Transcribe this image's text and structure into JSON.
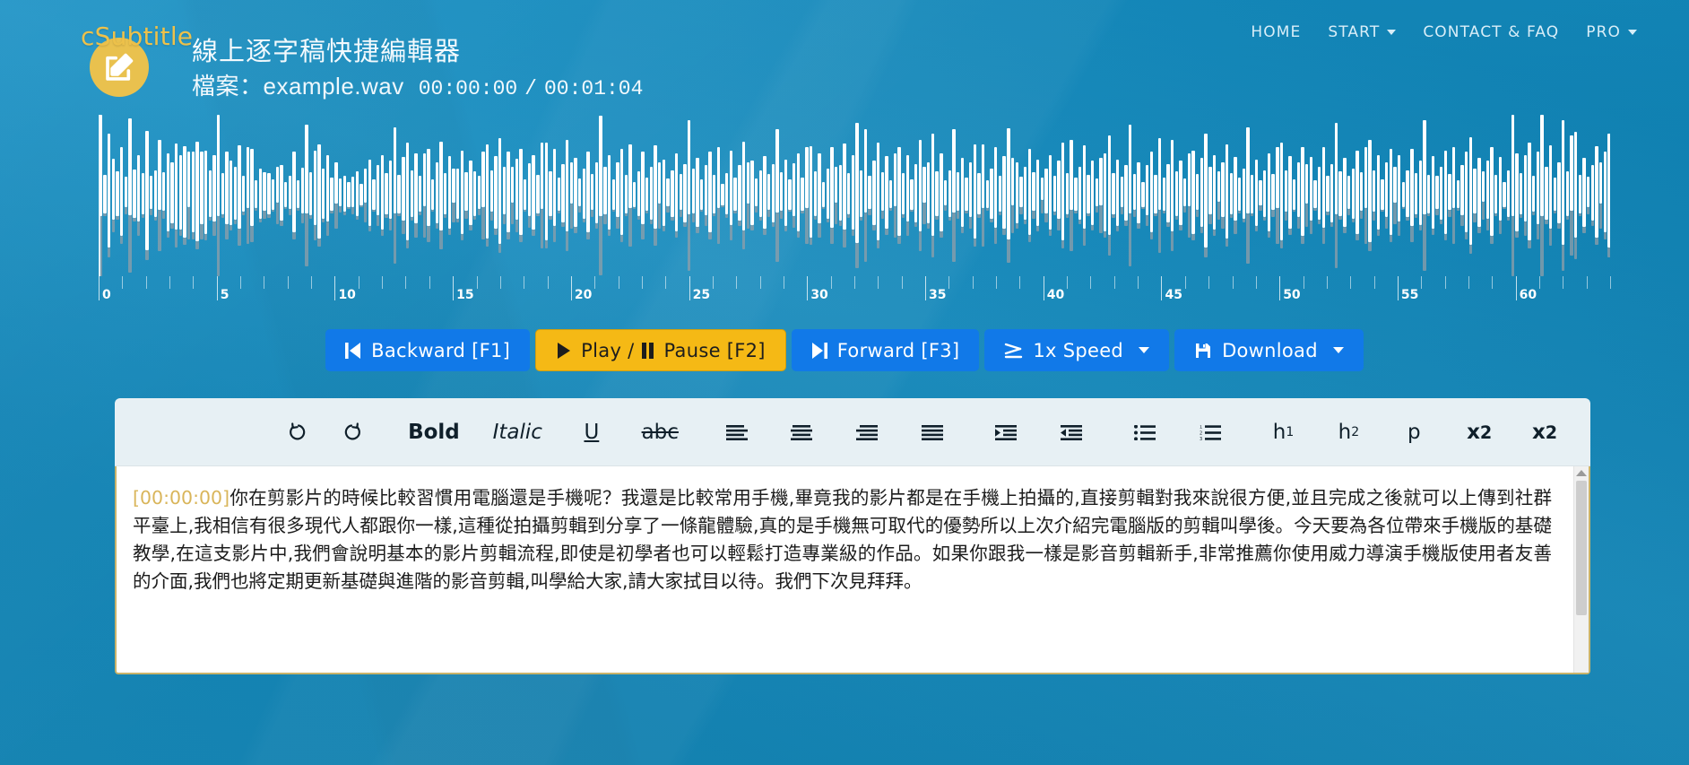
{
  "brand": {
    "logo_name": "cSubtitle",
    "logo_icon": "edit-square-icon"
  },
  "header": {
    "title": "線上逐字稿快捷編輯器",
    "file_label": "檔案：",
    "file_name": "example.wav",
    "time_current": "00:00:00",
    "time_separator": "/",
    "time_total": "00:01:04"
  },
  "nav": {
    "items": [
      {
        "label": "HOME",
        "has_caret": false
      },
      {
        "label": "START",
        "has_caret": true
      },
      {
        "label": "CONTACT & FAQ",
        "has_caret": false
      },
      {
        "label": "PRO",
        "has_caret": true
      }
    ]
  },
  "waveform": {
    "ruler_labels": [
      "0",
      "5",
      "10",
      "15",
      "20",
      "25",
      "30",
      "35",
      "40",
      "45",
      "50",
      "55",
      "60"
    ],
    "ruler_max_seconds": 64,
    "ruler_tick_interval": 1,
    "ruler_label_interval": 5,
    "playhead_seconds": 0,
    "peaks": [
      0.96,
      0.28,
      0.82,
      0.44,
      0.32,
      0.64,
      0.22,
      0.7,
      0.35,
      0.48,
      0.3,
      0.86,
      0.24,
      0.34,
      0.5,
      0.28,
      0.56,
      0.44,
      0.62,
      0.54,
      0.66,
      0.4,
      0.58,
      0.72,
      0.52,
      0.6,
      0.34,
      0.48,
      0.78,
      0.3,
      0.52,
      0.46,
      0.38,
      0.6,
      0.26,
      0.44,
      0.56,
      0.2,
      0.36,
      0.28,
      0.3,
      0.22,
      0.26,
      0.4,
      0.18,
      0.24,
      0.58,
      0.2,
      0.33,
      0.64,
      0.31,
      0.54,
      0.68,
      0.36,
      0.48,
      0.24,
      0.3,
      0.2,
      0.26,
      0.18,
      0.22,
      0.32,
      0.16,
      0.24,
      0.48,
      0.22,
      0.36,
      0.54,
      0.3,
      0.42,
      0.62,
      0.28,
      0.46,
      0.7,
      0.34,
      0.5,
      0.26,
      0.38,
      0.56,
      0.22,
      0.44,
      0.64,
      0.3,
      0.52,
      0.24,
      0.36,
      0.6,
      0.28,
      0.46,
      0.32,
      0.24,
      0.4,
      0.68,
      0.3,
      0.52,
      0.76,
      0.34,
      0.58,
      0.26,
      0.44,
      0.62,
      0.22,
      0.38,
      0.54,
      0.28,
      0.48,
      0.7,
      0.32,
      0.56,
      0.24,
      0.42,
      0.66,
      0.3,
      0.5,
      0.2,
      0.36,
      0.58,
      0.26,
      0.44,
      0.72,
      0.34,
      0.54,
      0.22,
      0.4,
      0.62,
      0.28,
      0.46,
      0.18,
      0.32,
      0.52,
      0.24,
      0.38,
      0.6,
      0.3,
      0.48,
      0.2,
      0.34,
      0.56,
      0.26,
      0.42,
      0.68,
      0.32,
      0.5,
      0.22,
      0.36,
      0.58,
      0.28,
      0.44,
      0.16,
      0.3,
      0.54,
      0.24,
      0.4,
      0.64,
      0.3,
      0.46,
      0.2,
      0.34,
      0.52,
      0.26,
      0.42,
      0.6,
      0.28,
      0.48,
      0.22,
      0.38,
      0.56,
      0.24,
      0.44,
      0.66,
      0.32,
      0.5,
      0.18,
      0.36,
      0.58,
      0.26,
      0.4,
      0.62,
      0.3,
      0.54,
      0.86,
      0.34,
      0.6,
      0.24,
      0.46,
      0.7,
      0.28,
      0.52,
      0.2,
      0.38,
      0.64,
      0.3,
      0.48,
      0.22,
      0.42,
      0.66,
      0.26,
      0.44,
      0.74,
      0.32,
      0.56,
      0.18,
      0.34,
      0.6,
      0.28,
      0.5,
      0.24,
      0.4,
      0.68,
      0.3,
      0.46,
      0.2,
      0.36,
      0.58,
      0.26,
      0.52,
      0.8,
      0.34,
      0.44,
      0.22,
      0.38,
      0.62,
      0.28,
      0.48,
      0.16,
      0.32,
      0.54,
      0.26,
      0.42,
      0.7,
      0.3,
      0.5,
      0.24,
      0.38,
      0.6,
      0.28,
      0.46,
      0.2,
      0.34,
      0.56,
      0.72,
      0.3,
      0.48,
      0.22,
      0.4,
      0.64,
      0.26,
      0.44,
      0.18,
      0.36,
      0.58,
      0.28,
      0.52,
      0.24,
      0.42,
      0.66,
      0.32,
      0.46,
      0.2,
      0.38,
      0.6,
      0.26,
      0.5,
      0.82,
      0.34,
      0.54,
      0.22,
      0.4,
      0.68,
      0.3,
      0.46,
      0.24,
      0.36,
      0.62,
      0.28,
      0.48,
      0.18,
      0.34,
      0.56,
      0.26,
      0.44,
      0.7,
      0.3,
      0.52,
      0.22,
      0.4,
      0.64,
      0.28,
      0.46,
      0.2,
      0.38,
      0.58,
      0.26,
      0.42,
      0.66,
      0.32,
      0.5,
      0.24,
      0.36,
      0.6,
      0.28,
      0.44,
      0.74,
      0.3,
      0.54,
      0.22,
      0.4,
      0.62,
      0.26,
      0.48,
      0.18,
      0.34,
      0.56,
      0.3,
      0.46,
      0.68,
      0.28,
      0.52,
      0.24,
      0.38,
      0.6,
      0.26,
      0.44,
      0.2,
      0.36,
      0.58,
      0.78,
      0.32,
      0.5,
      0.22,
      0.42,
      0.64,
      0.28,
      0.46,
      0.18,
      0.34,
      0.88,
      0.56,
      0.3,
      0.48,
      0.7,
      0.26,
      0.52,
      0.84,
      0.38,
      0.6,
      0.24,
      0.44,
      0.9,
      0.32,
      0.54,
      0.76,
      0.28,
      0.5,
      0.22,
      0.4,
      0.66,
      0.3,
      0.58,
      0.82
    ],
    "bar_color": "#ffffff",
    "progress_color": "#96a0a8"
  },
  "controls": [
    {
      "name": "backward",
      "icon": "skip-backward-icon",
      "label": "Backward [F1]",
      "style": "primary",
      "caret": false
    },
    {
      "name": "play-pause",
      "icon": "play-pause-icon",
      "label_play": "Play / ",
      "label_pause": "Pause [F2]",
      "style": "warning",
      "caret": false
    },
    {
      "name": "forward",
      "icon": "skip-forward-icon",
      "label": "Forward [F3]",
      "style": "primary",
      "caret": false
    },
    {
      "name": "speed",
      "icon": "speedometer-icon",
      "label": "1x Speed",
      "style": "primary",
      "caret": true
    },
    {
      "name": "download",
      "icon": "save-disk-icon",
      "label": "Download",
      "style": "primary",
      "caret": true
    }
  ],
  "editor_toolbar": {
    "items": [
      {
        "name": "undo",
        "glyph": "↺",
        "kind": "icon"
      },
      {
        "name": "redo",
        "glyph": "↻",
        "kind": "icon"
      },
      {
        "name": "bold",
        "glyph": "Bold",
        "kind": "bold"
      },
      {
        "name": "italic",
        "glyph": "Italic",
        "kind": "ital"
      },
      {
        "name": "underline",
        "glyph": "U",
        "kind": "undl"
      },
      {
        "name": "strikethrough",
        "glyph": "abc",
        "kind": "strk"
      },
      {
        "name": "align-left",
        "glyph": "",
        "kind": "svg-align-left"
      },
      {
        "name": "align-center",
        "glyph": "",
        "kind": "svg-align-center"
      },
      {
        "name": "align-right",
        "glyph": "",
        "kind": "svg-align-right"
      },
      {
        "name": "align-justify",
        "glyph": "",
        "kind": "svg-align-justify"
      },
      {
        "name": "indent",
        "glyph": "",
        "kind": "svg-indent"
      },
      {
        "name": "outdent",
        "glyph": "",
        "kind": "svg-outdent"
      },
      {
        "name": "bullet-list",
        "glyph": "",
        "kind": "svg-ul"
      },
      {
        "name": "numbered-list",
        "glyph": "",
        "kind": "svg-ol"
      },
      {
        "name": "heading-1",
        "glyph": "h1",
        "kind": "hx"
      },
      {
        "name": "heading-2",
        "glyph": "h2",
        "kind": "hx"
      },
      {
        "name": "paragraph",
        "glyph": "p",
        "kind": "plain"
      },
      {
        "name": "subscript",
        "glyph": "x2",
        "kind": "sub"
      },
      {
        "name": "superscript",
        "glyph": "x2",
        "kind": "sup"
      }
    ]
  },
  "editor": {
    "timestamp": "[00:00:00]",
    "transcript": "你在剪影片的時候比較習慣用電腦還是手機呢？我還是比較常用手機,畢竟我的影片都是在手機上拍攝的,直接剪輯對我來說很方便,並且完成之後就可以上傳到社群平臺上,我相信有很多現代人都跟你一樣,這種從拍攝剪輯到分享了一條龍體驗,真的是手機無可取代的優勢所以上次介紹完電腦版的剪輯叫學後。今天要為各位帶來手機版的基礎教學,在這支影片中,我們會說明基本的影片剪輯流程,即使是初學者也可以輕鬆打造專業級的作品。如果你跟我一樣是影音剪輯新手,非常推薦你使用威力導演手機版使用者友善的介面,我們也將定期更新基礎與進階的影音剪輯,叫學給大家,請大家拭目以待。我們下次見拜拜。",
    "border_color": "#c9b36a",
    "timestamp_color": "#d9b55a"
  },
  "theme": {
    "background": "#1189bf",
    "primary_button": "#1179e8",
    "warning_button": "#f5b915",
    "logo_gold": "#e9c14e",
    "toolbar_bg": "#e7f0f4"
  }
}
